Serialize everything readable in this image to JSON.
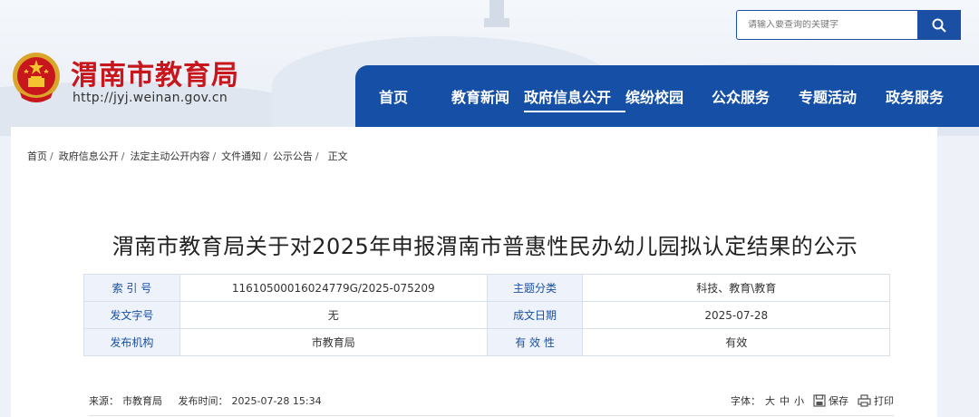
{
  "header": {
    "site_title": "渭南市教育局",
    "site_url": "http://jyj.weinan.gov.cn",
    "search_placeholder": "请输入要查询的关键字"
  },
  "nav": {
    "items": [
      {
        "label": "首页"
      },
      {
        "label": "教育新闻"
      },
      {
        "label": "政府信息公开"
      },
      {
        "label": "缤纷校园"
      },
      {
        "label": "公众服务"
      },
      {
        "label": "专题活动"
      },
      {
        "label": "政务服务"
      }
    ],
    "active_label": "政府信息公开"
  },
  "breadcrumb": {
    "items": [
      "首页",
      "政府信息公开",
      "法定主动公开内容",
      "文件通知",
      "公示公告",
      "正文"
    ]
  },
  "article": {
    "title": "渭南市教育局关于对2025年申报渭南市普惠性民办幼儿园拟认定结果的公示"
  },
  "meta": {
    "rows": [
      {
        "label1": "索 引 号",
        "value1": "11610500016024779G/2025-075209",
        "label2": "主题分类",
        "value2": "科技、教育\\教育"
      },
      {
        "label1": "发文字号",
        "value1": "无",
        "label2": "成文日期",
        "value2": "2025-07-28"
      },
      {
        "label1": "发布机构",
        "value1": "市教育局",
        "label2": "有 效 性",
        "value2": "有效"
      }
    ]
  },
  "source": {
    "source_label": "来源：",
    "source_value": "市教育局",
    "time_label": "发布时间：",
    "time_value": "2025-07-28 15:34",
    "font_label": "字体：",
    "font_big": "大",
    "font_mid": "中",
    "font_small": "小",
    "save_label": "保存",
    "print_label": "打印"
  },
  "colors": {
    "primary": "#1550a6",
    "brand_red": "#c8161d",
    "table_label_bg": "#eef3fb"
  }
}
